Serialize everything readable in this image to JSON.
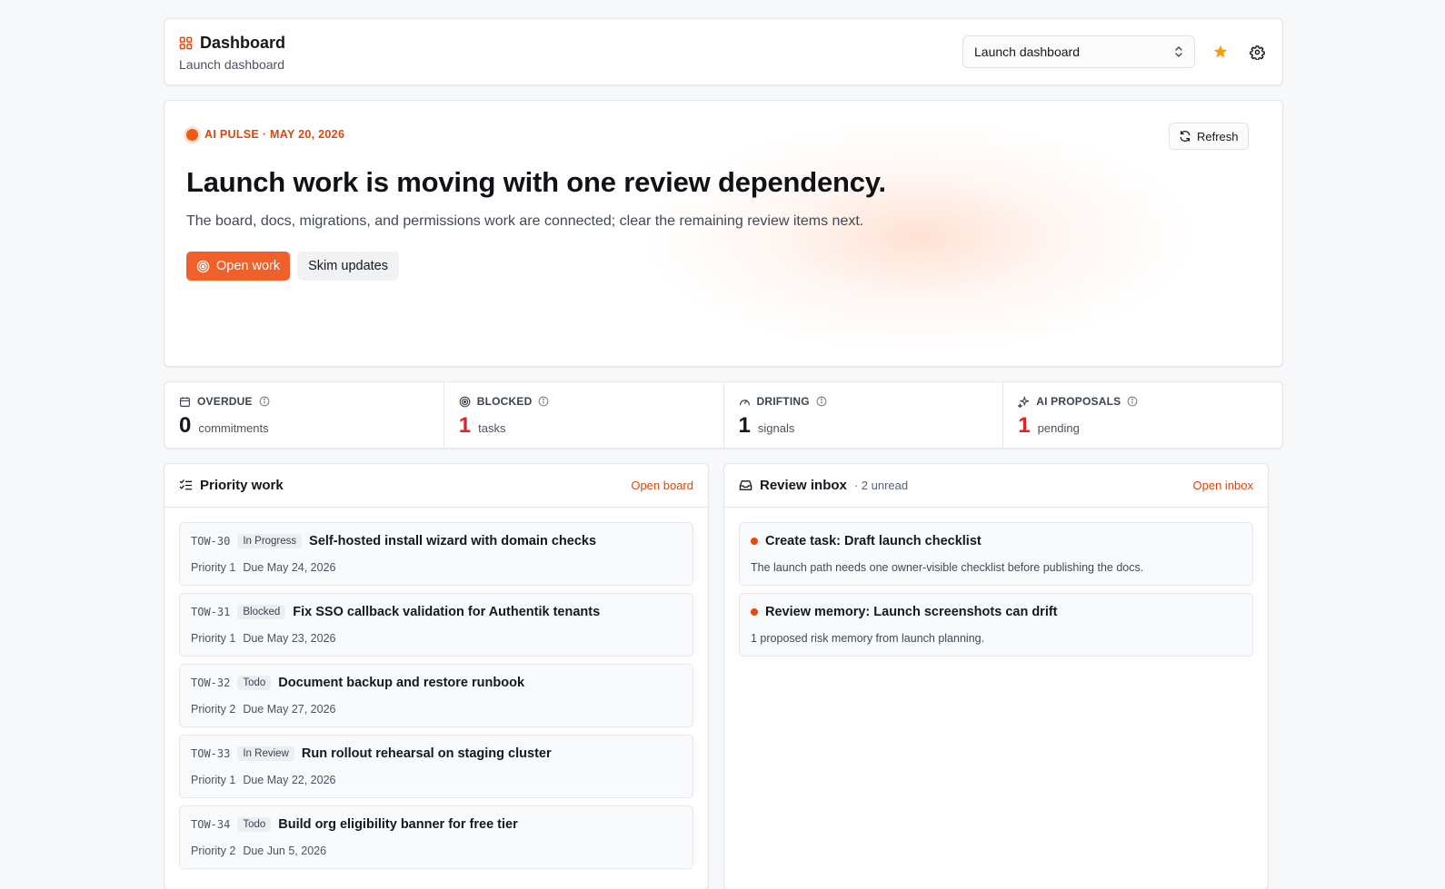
{
  "colors": {
    "accent": "#f0602b",
    "accent_text": "#d9480f",
    "danger_value": "#dc2626",
    "star": "#f59e0b"
  },
  "header": {
    "title": "Dashboard",
    "subtitle": "Launch dashboard",
    "icon": "layout-grid-icon",
    "dashboard_select": {
      "value": "Launch dashboard"
    }
  },
  "hero": {
    "eyebrow": "AI PULSE · MAY 20, 2026",
    "headline": "Launch work is moving with one review dependency.",
    "summary": "The board, docs, migrations, and permissions work are connected; clear the remaining review items next.",
    "primary_action": "Open work",
    "secondary_action": "Skim updates",
    "refresh_label": "Refresh"
  },
  "stats": [
    {
      "label": "OVERDUE",
      "value": "0",
      "unit": "commitments",
      "icon": "calendar-icon",
      "value_color": "#15181e"
    },
    {
      "label": "BLOCKED",
      "value": "1",
      "unit": "tasks",
      "icon": "target-icon",
      "value_color": "#dc2626"
    },
    {
      "label": "DRIFTING",
      "value": "1",
      "unit": "signals",
      "icon": "gauge-icon",
      "value_color": "#15181e"
    },
    {
      "label": "AI PROPOSALS",
      "value": "1",
      "unit": "pending",
      "icon": "sparkles-icon",
      "value_color": "#dc2626"
    }
  ],
  "priority_work": {
    "title": "Priority work",
    "link": "Open board",
    "tasks": [
      {
        "id": "TOW-30",
        "status": "In Progress",
        "title": "Self-hosted install wizard with domain checks",
        "priority": "Priority 1",
        "due": "Due May 24, 2026"
      },
      {
        "id": "TOW-31",
        "status": "Blocked",
        "title": "Fix SSO callback validation for Authentik tenants",
        "priority": "Priority 1",
        "due": "Due May 23, 2026"
      },
      {
        "id": "TOW-32",
        "status": "Todo",
        "title": "Document backup and restore runbook",
        "priority": "Priority 2",
        "due": "Due May 27, 2026"
      },
      {
        "id": "TOW-33",
        "status": "In Review",
        "title": "Run rollout rehearsal on staging cluster",
        "priority": "Priority 1",
        "due": "Due May 22, 2026"
      },
      {
        "id": "TOW-34",
        "status": "Todo",
        "title": "Build org eligibility banner for free tier",
        "priority": "Priority 2",
        "due": "Due Jun 5, 2026"
      }
    ]
  },
  "review_inbox": {
    "title": "Review inbox",
    "meta": "· 2 unread",
    "link": "Open inbox",
    "items": [
      {
        "title": "Create task: Draft launch checklist",
        "desc": "The launch path needs one owner-visible checklist before publishing the docs."
      },
      {
        "title": "Review memory: Launch screenshots can drift",
        "desc": "1 proposed risk memory from launch planning."
      }
    ]
  }
}
